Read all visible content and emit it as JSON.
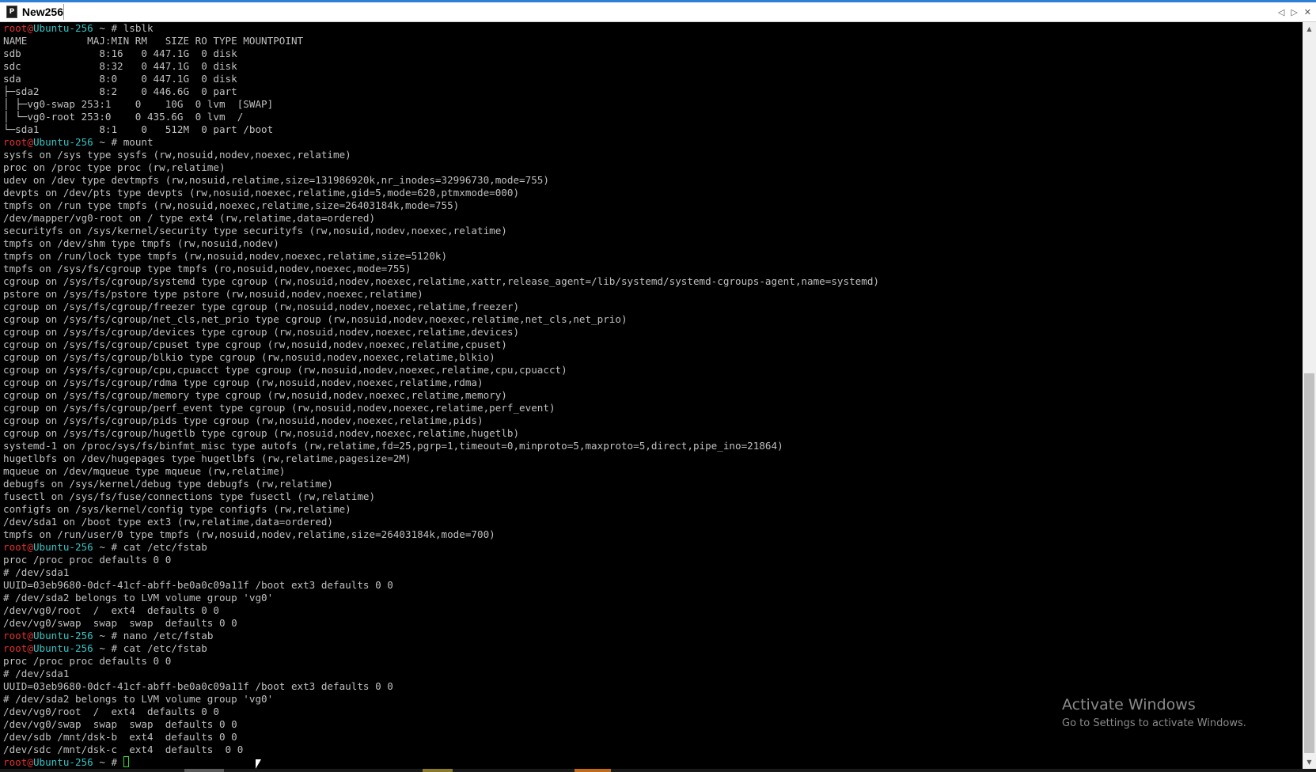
{
  "window": {
    "tab_title": "New256",
    "tab_icon_glyph": "P",
    "controls": {
      "prev": "◁",
      "next": "▷",
      "close": "✕"
    }
  },
  "prompt": {
    "user": "root",
    "at": "@",
    "host": "Ubuntu-256",
    "suffix": " ~ # "
  },
  "terminal": {
    "lines": [
      {
        "type": "prompt",
        "cmd": "lsblk"
      },
      {
        "type": "out",
        "text": "NAME          MAJ:MIN RM   SIZE RO TYPE MOUNTPOINT"
      },
      {
        "type": "out",
        "text": "sdb             8:16   0 447.1G  0 disk"
      },
      {
        "type": "out",
        "text": "sdc             8:32   0 447.1G  0 disk"
      },
      {
        "type": "out",
        "text": "sda             8:0    0 447.1G  0 disk"
      },
      {
        "type": "out",
        "text": "├─sda2          8:2    0 446.6G  0 part"
      },
      {
        "type": "out",
        "text": "│ ├─vg0-swap 253:1    0    10G  0 lvm  [SWAP]"
      },
      {
        "type": "out",
        "text": "│ └─vg0-root 253:0    0 435.6G  0 lvm  /"
      },
      {
        "type": "out",
        "text": "└─sda1          8:1    0   512M  0 part /boot"
      },
      {
        "type": "prompt",
        "cmd": "mount"
      },
      {
        "type": "out",
        "text": "sysfs on /sys type sysfs (rw,nosuid,nodev,noexec,relatime)"
      },
      {
        "type": "out",
        "text": "proc on /proc type proc (rw,relatime)"
      },
      {
        "type": "out",
        "text": "udev on /dev type devtmpfs (rw,nosuid,relatime,size=131986920k,nr_inodes=32996730,mode=755)"
      },
      {
        "type": "out",
        "text": "devpts on /dev/pts type devpts (rw,nosuid,noexec,relatime,gid=5,mode=620,ptmxmode=000)"
      },
      {
        "type": "out",
        "text": "tmpfs on /run type tmpfs (rw,nosuid,noexec,relatime,size=26403184k,mode=755)"
      },
      {
        "type": "out",
        "text": "/dev/mapper/vg0-root on / type ext4 (rw,relatime,data=ordered)"
      },
      {
        "type": "out",
        "text": "securityfs on /sys/kernel/security type securityfs (rw,nosuid,nodev,noexec,relatime)"
      },
      {
        "type": "out",
        "text": "tmpfs on /dev/shm type tmpfs (rw,nosuid,nodev)"
      },
      {
        "type": "out",
        "text": "tmpfs on /run/lock type tmpfs (rw,nosuid,nodev,noexec,relatime,size=5120k)"
      },
      {
        "type": "out",
        "text": "tmpfs on /sys/fs/cgroup type tmpfs (ro,nosuid,nodev,noexec,mode=755)"
      },
      {
        "type": "out",
        "text": "cgroup on /sys/fs/cgroup/systemd type cgroup (rw,nosuid,nodev,noexec,relatime,xattr,release_agent=/lib/systemd/systemd-cgroups-agent,name=systemd)"
      },
      {
        "type": "out",
        "text": "pstore on /sys/fs/pstore type pstore (rw,nosuid,nodev,noexec,relatime)"
      },
      {
        "type": "out",
        "text": "cgroup on /sys/fs/cgroup/freezer type cgroup (rw,nosuid,nodev,noexec,relatime,freezer)"
      },
      {
        "type": "out",
        "text": "cgroup on /sys/fs/cgroup/net_cls,net_prio type cgroup (rw,nosuid,nodev,noexec,relatime,net_cls,net_prio)"
      },
      {
        "type": "out",
        "text": "cgroup on /sys/fs/cgroup/devices type cgroup (rw,nosuid,nodev,noexec,relatime,devices)"
      },
      {
        "type": "out",
        "text": "cgroup on /sys/fs/cgroup/cpuset type cgroup (rw,nosuid,nodev,noexec,relatime,cpuset)"
      },
      {
        "type": "out",
        "text": "cgroup on /sys/fs/cgroup/blkio type cgroup (rw,nosuid,nodev,noexec,relatime,blkio)"
      },
      {
        "type": "out",
        "text": "cgroup on /sys/fs/cgroup/cpu,cpuacct type cgroup (rw,nosuid,nodev,noexec,relatime,cpu,cpuacct)"
      },
      {
        "type": "out",
        "text": "cgroup on /sys/fs/cgroup/rdma type cgroup (rw,nosuid,nodev,noexec,relatime,rdma)"
      },
      {
        "type": "out",
        "text": "cgroup on /sys/fs/cgroup/memory type cgroup (rw,nosuid,nodev,noexec,relatime,memory)"
      },
      {
        "type": "out",
        "text": "cgroup on /sys/fs/cgroup/perf_event type cgroup (rw,nosuid,nodev,noexec,relatime,perf_event)"
      },
      {
        "type": "out",
        "text": "cgroup on /sys/fs/cgroup/pids type cgroup (rw,nosuid,nodev,noexec,relatime,pids)"
      },
      {
        "type": "out",
        "text": "cgroup on /sys/fs/cgroup/hugetlb type cgroup (rw,nosuid,nodev,noexec,relatime,hugetlb)"
      },
      {
        "type": "out",
        "text": "systemd-1 on /proc/sys/fs/binfmt_misc type autofs (rw,relatime,fd=25,pgrp=1,timeout=0,minproto=5,maxproto=5,direct,pipe_ino=21864)"
      },
      {
        "type": "out",
        "text": "hugetlbfs on /dev/hugepages type hugetlbfs (rw,relatime,pagesize=2M)"
      },
      {
        "type": "out",
        "text": "mqueue on /dev/mqueue type mqueue (rw,relatime)"
      },
      {
        "type": "out",
        "text": "debugfs on /sys/kernel/debug type debugfs (rw,relatime)"
      },
      {
        "type": "out",
        "text": "fusectl on /sys/fs/fuse/connections type fusectl (rw,relatime)"
      },
      {
        "type": "out",
        "text": "configfs on /sys/kernel/config type configfs (rw,relatime)"
      },
      {
        "type": "out",
        "text": "/dev/sda1 on /boot type ext3 (rw,relatime,data=ordered)"
      },
      {
        "type": "out",
        "text": "tmpfs on /run/user/0 type tmpfs (rw,nosuid,nodev,relatime,size=26403184k,mode=700)"
      },
      {
        "type": "prompt",
        "cmd": "cat /etc/fstab"
      },
      {
        "type": "out",
        "text": "proc /proc proc defaults 0 0"
      },
      {
        "type": "out",
        "text": "# /dev/sda1"
      },
      {
        "type": "out",
        "text": "UUID=03eb9680-0dcf-41cf-abff-be0a0c09a11f /boot ext3 defaults 0 0"
      },
      {
        "type": "out",
        "text": "# /dev/sda2 belongs to LVM volume group 'vg0'"
      },
      {
        "type": "out",
        "text": "/dev/vg0/root  /  ext4  defaults 0 0"
      },
      {
        "type": "out",
        "text": "/dev/vg0/swap  swap  swap  defaults 0 0"
      },
      {
        "type": "prompt",
        "cmd": "nano /etc/fstab"
      },
      {
        "type": "prompt",
        "cmd": "cat /etc/fstab"
      },
      {
        "type": "out",
        "text": "proc /proc proc defaults 0 0"
      },
      {
        "type": "out",
        "text": "# /dev/sda1"
      },
      {
        "type": "out",
        "text": "UUID=03eb9680-0dcf-41cf-abff-be0a0c09a11f /boot ext3 defaults 0 0"
      },
      {
        "type": "out",
        "text": "# /dev/sda2 belongs to LVM volume group 'vg0'"
      },
      {
        "type": "out",
        "text": "/dev/vg0/root  /  ext4  defaults 0 0"
      },
      {
        "type": "out",
        "text": "/dev/vg0/swap  swap  swap  defaults 0 0"
      },
      {
        "type": "out",
        "text": "/dev/sdb /mnt/dsk-b  ext4  defaults 0 0"
      },
      {
        "type": "out",
        "text": "/dev/sdc /mnt/dsk-c  ext4  defaults  0 0"
      },
      {
        "type": "prompt",
        "cmd": "",
        "cursor": true
      }
    ]
  },
  "watermark": {
    "title": "Activate Windows",
    "subtitle": "Go to Settings to activate Windows."
  },
  "scrollbar": {
    "up": "▲",
    "down": "▼"
  },
  "colors": {
    "prompt_user": "#e53030",
    "prompt_host": "#31c5c5",
    "output": "#c0c0c0",
    "cursor": "#2fe02f",
    "background": "#000000"
  }
}
